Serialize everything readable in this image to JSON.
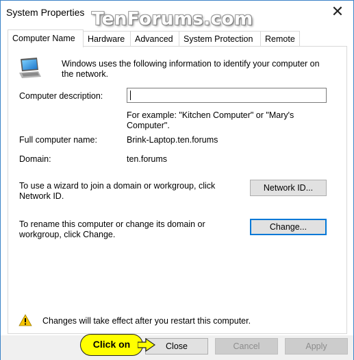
{
  "window": {
    "title": "System Properties",
    "watermark": "TenForums.com",
    "close_glyph": "✕"
  },
  "tabs": [
    {
      "label": "Computer Name",
      "active": true
    },
    {
      "label": "Hardware",
      "active": false
    },
    {
      "label": "Advanced",
      "active": false
    },
    {
      "label": "System Protection",
      "active": false
    },
    {
      "label": "Remote",
      "active": false
    }
  ],
  "panel": {
    "intro_line1": "Windows uses the following information to identify your computer on",
    "intro_line2": "the network.",
    "computer_icon": "computer-monitor-icon",
    "description_label": "Computer description:",
    "description_value": "",
    "example_line1": "For example: \"Kitchen Computer\" or \"Mary's",
    "example_line2": "Computer\".",
    "full_name_label": "Full computer name:",
    "full_name_value": "Brink-Laptop.ten.forums",
    "domain_label": "Domain:",
    "domain_value": "ten.forums",
    "wizard_line1": "To use a wizard to join a domain or workgroup, click",
    "wizard_line2": "Network ID.",
    "network_id_button": "Network ID...",
    "rename_line1": "To rename this computer or change its domain or",
    "rename_line2": "workgroup, click Change.",
    "change_button": "Change...",
    "warning_icon": "warning-icon",
    "warning_text": "Changes will take effect after you restart this computer."
  },
  "footer": {
    "close_button": "Close",
    "cancel_button": "Cancel",
    "apply_button": "Apply"
  },
  "callout": {
    "text": "Click on",
    "color": "#ffff00"
  },
  "colors": {
    "accent": "#0078d7",
    "window_border": "#3a82c7",
    "warning": "#f5c400"
  }
}
